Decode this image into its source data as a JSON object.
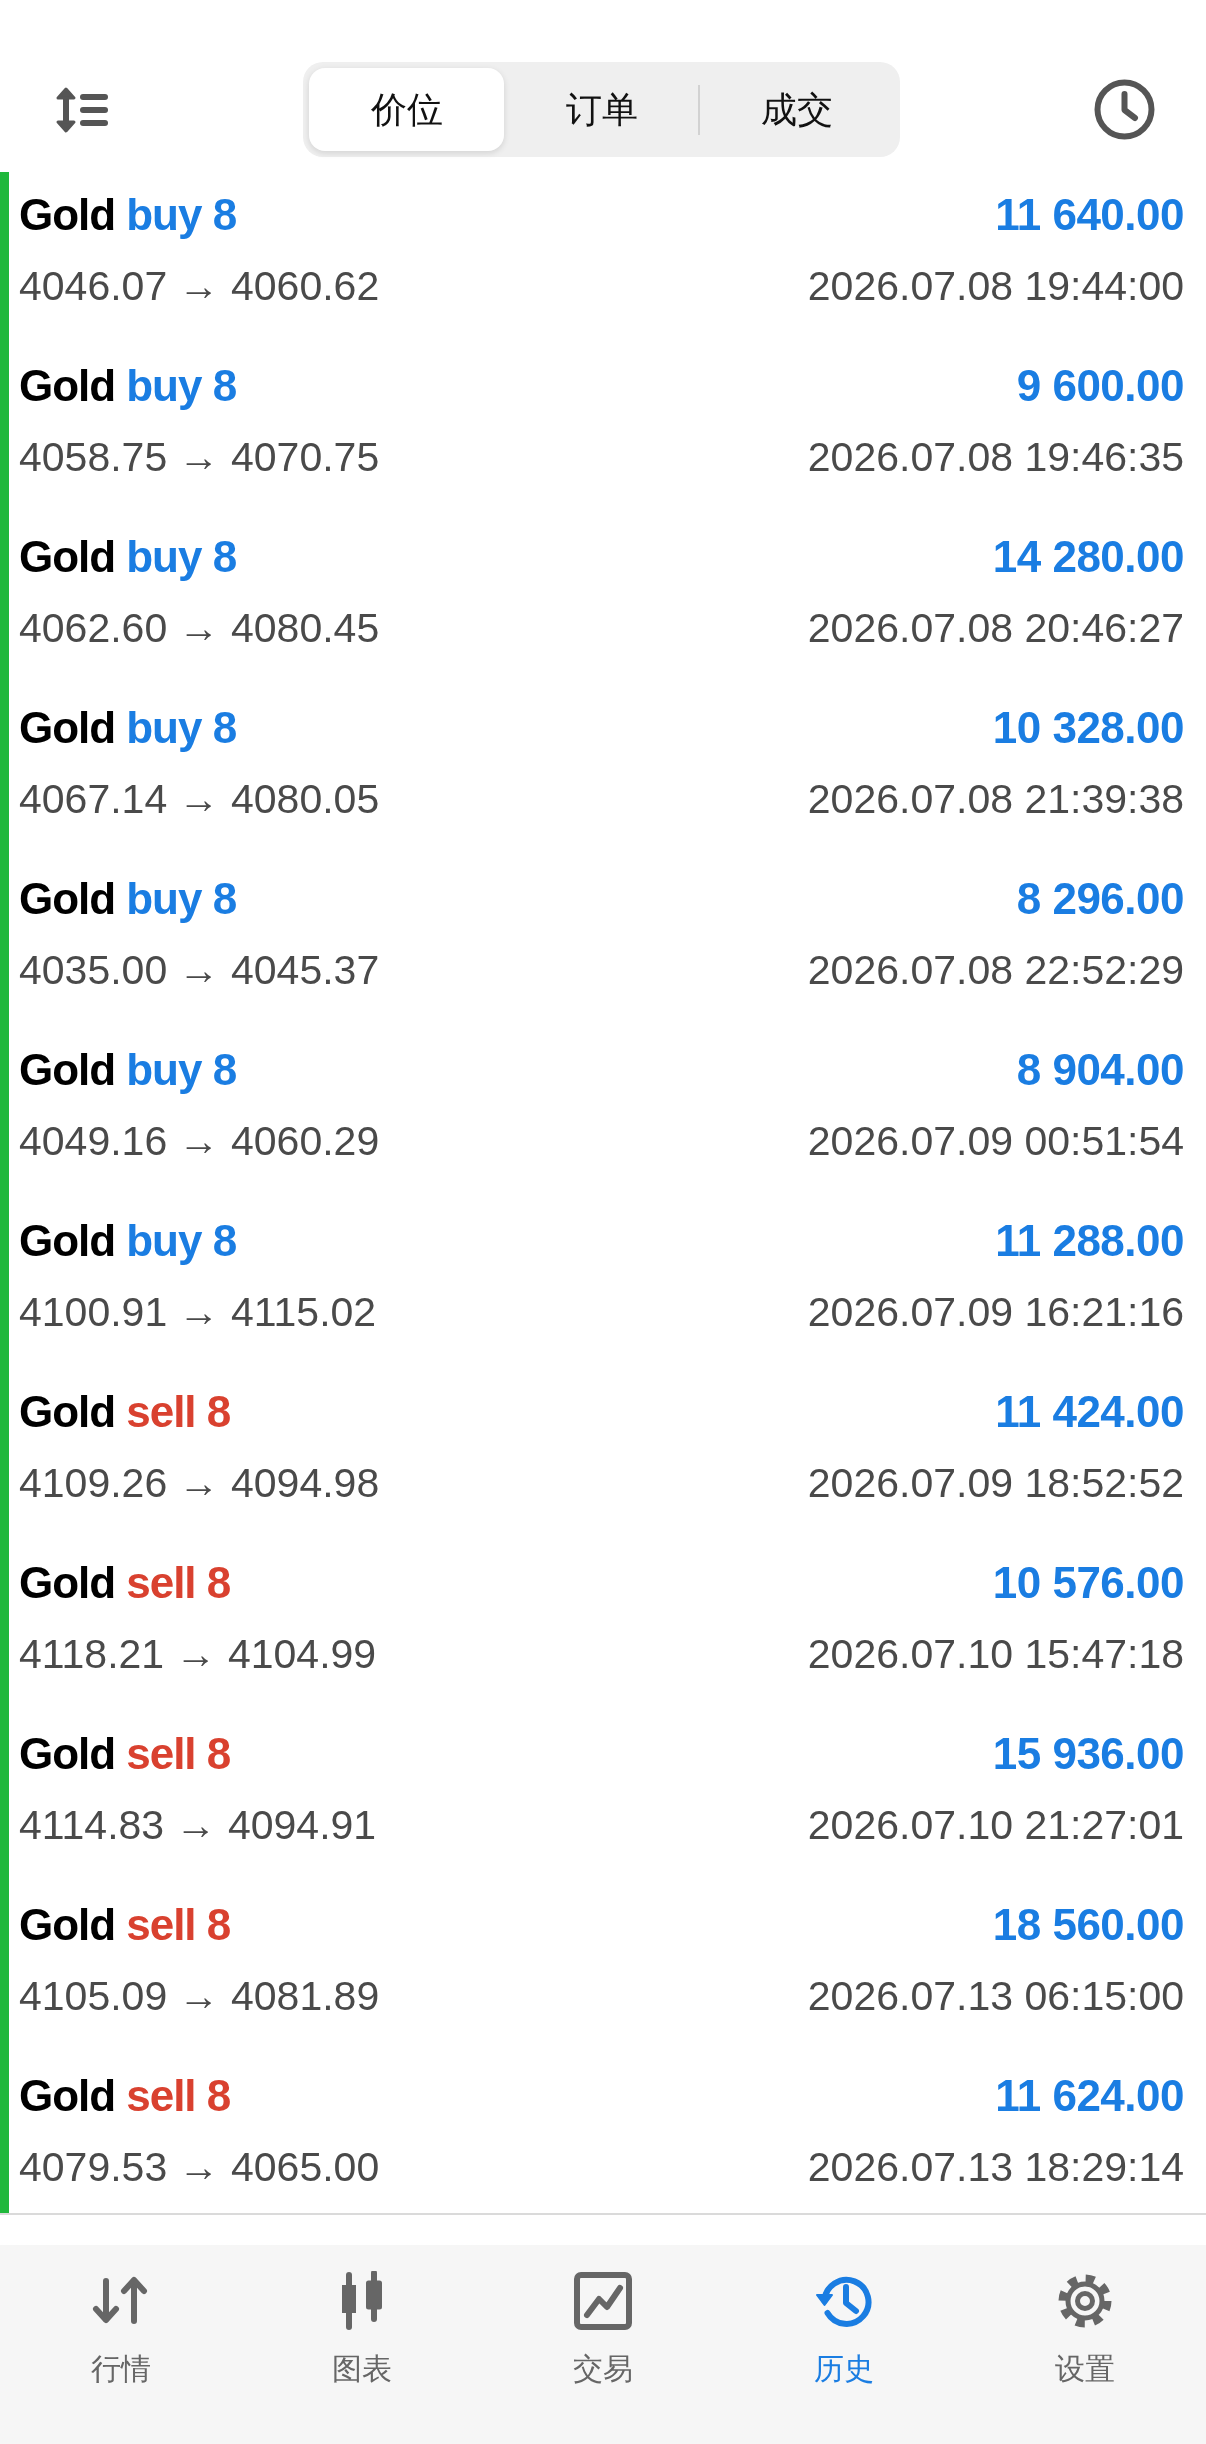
{
  "header": {
    "segments": [
      {
        "label": "价位",
        "selected": true
      },
      {
        "label": "订单",
        "selected": false
      },
      {
        "label": "成交",
        "selected": false
      }
    ]
  },
  "deals": [
    {
      "symbol": "Gold",
      "kind": "buy",
      "type": "buy 8",
      "profit": "11 640.00",
      "prices": "4046.07 → 4060.62",
      "time": "2026.07.08 19:44:00"
    },
    {
      "symbol": "Gold",
      "kind": "buy",
      "type": "buy 8",
      "profit": "9 600.00",
      "prices": "4058.75 → 4070.75",
      "time": "2026.07.08 19:46:35"
    },
    {
      "symbol": "Gold",
      "kind": "buy",
      "type": "buy 8",
      "profit": "14 280.00",
      "prices": "4062.60 → 4080.45",
      "time": "2026.07.08 20:46:27"
    },
    {
      "symbol": "Gold",
      "kind": "buy",
      "type": "buy 8",
      "profit": "10 328.00",
      "prices": "4067.14 → 4080.05",
      "time": "2026.07.08 21:39:38"
    },
    {
      "symbol": "Gold",
      "kind": "buy",
      "type": "buy 8",
      "profit": "8 296.00",
      "prices": "4035.00 → 4045.37",
      "time": "2026.07.08 22:52:29"
    },
    {
      "symbol": "Gold",
      "kind": "buy",
      "type": "buy 8",
      "profit": "8 904.00",
      "prices": "4049.16 → 4060.29",
      "time": "2026.07.09 00:51:54"
    },
    {
      "symbol": "Gold",
      "kind": "buy",
      "type": "buy 8",
      "profit": "11 288.00",
      "prices": "4100.91 → 4115.02",
      "time": "2026.07.09 16:21:16"
    },
    {
      "symbol": "Gold",
      "kind": "sell",
      "type": "sell 8",
      "profit": "11 424.00",
      "prices": "4109.26 → 4094.98",
      "time": "2026.07.09 18:52:52"
    },
    {
      "symbol": "Gold",
      "kind": "sell",
      "type": "sell 8",
      "profit": "10 576.00",
      "prices": "4118.21 → 4104.99",
      "time": "2026.07.10 15:47:18"
    },
    {
      "symbol": "Gold",
      "kind": "sell",
      "type": "sell 8",
      "profit": "15 936.00",
      "prices": "4114.83 → 4094.91",
      "time": "2026.07.10 21:27:01"
    },
    {
      "symbol": "Gold",
      "kind": "sell",
      "type": "sell 8",
      "profit": "18 560.00",
      "prices": "4105.09 → 4081.89",
      "time": "2026.07.13 06:15:00"
    },
    {
      "symbol": "Gold",
      "kind": "sell",
      "type": "sell 8",
      "profit": "11 624.00",
      "prices": "4079.53 → 4065.00",
      "time": "2026.07.13 18:29:14"
    }
  ],
  "tab_bar": [
    {
      "label": "行情",
      "selected": false
    },
    {
      "label": "图表",
      "selected": false
    },
    {
      "label": "交易",
      "selected": false
    },
    {
      "label": "历史",
      "selected": true
    },
    {
      "label": "设置",
      "selected": false
    }
  ]
}
